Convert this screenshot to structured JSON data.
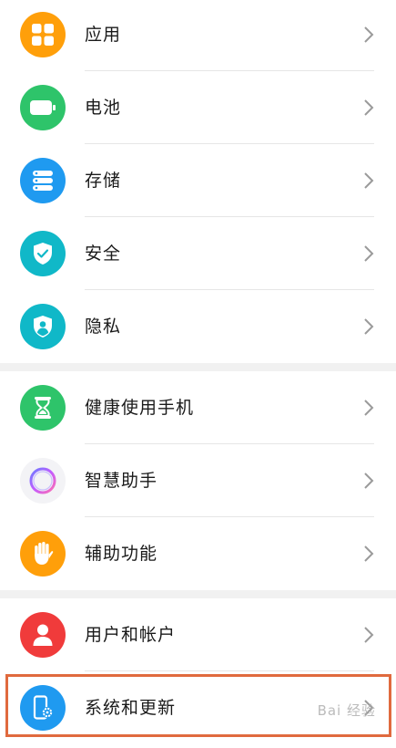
{
  "settings": {
    "group1": [
      {
        "label": "应用",
        "icon": "apps-grid-icon",
        "color": "#ff9f0a"
      },
      {
        "label": "电池",
        "icon": "battery-icon",
        "color": "#2ec46a"
      },
      {
        "label": "存储",
        "icon": "storage-icon",
        "color": "#1f9af0"
      },
      {
        "label": "安全",
        "icon": "shield-check-icon",
        "color": "#10b8c8"
      },
      {
        "label": "隐私",
        "icon": "privacy-shield-icon",
        "color": "#10b8c8"
      }
    ],
    "group2": [
      {
        "label": "健康使用手机",
        "icon": "hourglass-icon",
        "color": "#2ec46a"
      },
      {
        "label": "智慧助手",
        "icon": "assistant-orb-icon",
        "color": "#f3f3f6"
      },
      {
        "label": "辅助功能",
        "icon": "hand-icon",
        "color": "#ff9f0a"
      }
    ],
    "group3": [
      {
        "label": "用户和帐户",
        "icon": "user-icon",
        "color": "#f03b3b"
      },
      {
        "label": "系统和更新",
        "icon": "phone-settings-icon",
        "color": "#1f9af0"
      }
    ]
  },
  "highlight_color": "#e06a3e",
  "watermark": "Bai 经验"
}
